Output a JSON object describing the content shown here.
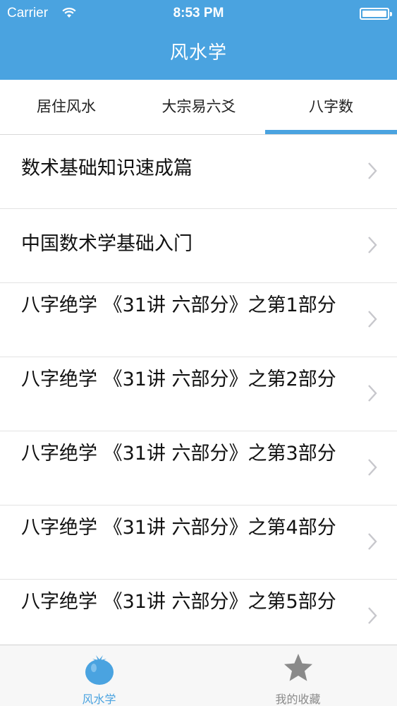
{
  "status_bar": {
    "carrier": "Carrier",
    "time": "8:53 PM"
  },
  "nav": {
    "title": "风水学"
  },
  "tabs": [
    {
      "label": "居住风水",
      "selected": false
    },
    {
      "label": "大宗易六爻",
      "selected": false
    },
    {
      "label": "八字数",
      "selected": true
    }
  ],
  "list": {
    "items": [
      {
        "label": "数术基础知识速成篇"
      },
      {
        "label": "中国数术学基础入门"
      },
      {
        "label": "八字绝学 《31讲 六部分》之第1部分"
      },
      {
        "label": "八字绝学 《31讲 六部分》之第2部分"
      },
      {
        "label": "八字绝学 《31讲 六部分》之第3部分"
      },
      {
        "label": "八字绝学 《31讲 六部分》之第4部分"
      },
      {
        "label": "八字绝学 《31讲 六部分》之第5部分"
      }
    ]
  },
  "tabbar": {
    "items": [
      {
        "label": "风水学",
        "icon": "tomato-icon",
        "selected": true
      },
      {
        "label": "我的收藏",
        "icon": "star-icon",
        "selected": false
      }
    ]
  },
  "colors": {
    "accent": "#4aa3e0",
    "text": "#111111",
    "inactive": "#8a8a8a"
  }
}
